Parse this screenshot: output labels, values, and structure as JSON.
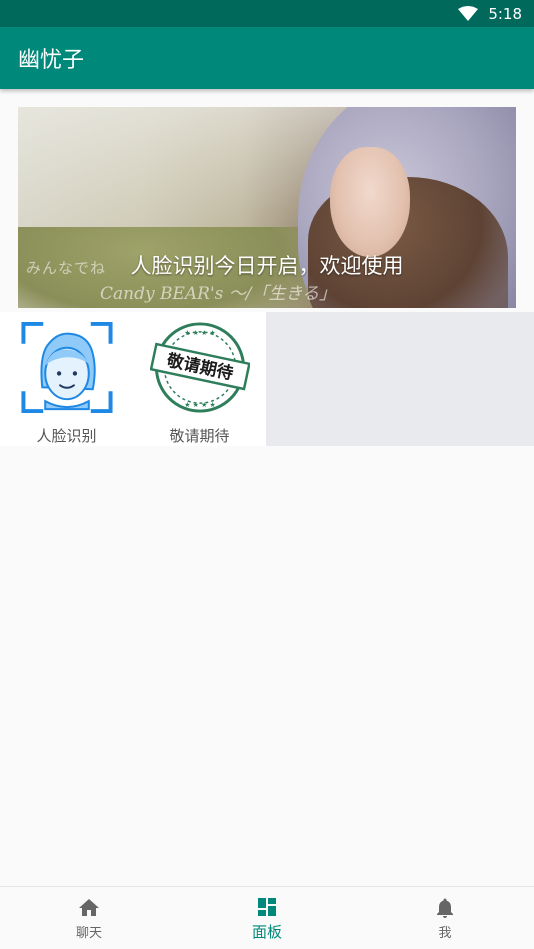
{
  "status_bar": {
    "time": "5:18"
  },
  "app_bar": {
    "title": "幽忧子"
  },
  "banner": {
    "caption": "人脸识别今日开启，欢迎使用",
    "watermark_line1": "みんなでね",
    "watermark_line2": "Candy BEAR's ～/「生きる」"
  },
  "features": [
    {
      "label": "人脸识别",
      "icon": "face-recognition-icon"
    },
    {
      "label": "敬请期待",
      "icon": "coming-soon-stamp",
      "stamp_text": "敬请期待"
    }
  ],
  "bottom_nav": {
    "items": [
      {
        "label": "聊天",
        "icon": "home-icon",
        "active": false
      },
      {
        "label": "面板",
        "icon": "dashboard-icon",
        "active": true
      },
      {
        "label": "我",
        "icon": "bell-icon",
        "active": false
      }
    ]
  },
  "colors": {
    "status_bar": "#00695c",
    "app_bar": "#00897b",
    "accent": "#00897b",
    "stamp_green": "#2e7d5b",
    "face_blue": "#1e88e5"
  }
}
